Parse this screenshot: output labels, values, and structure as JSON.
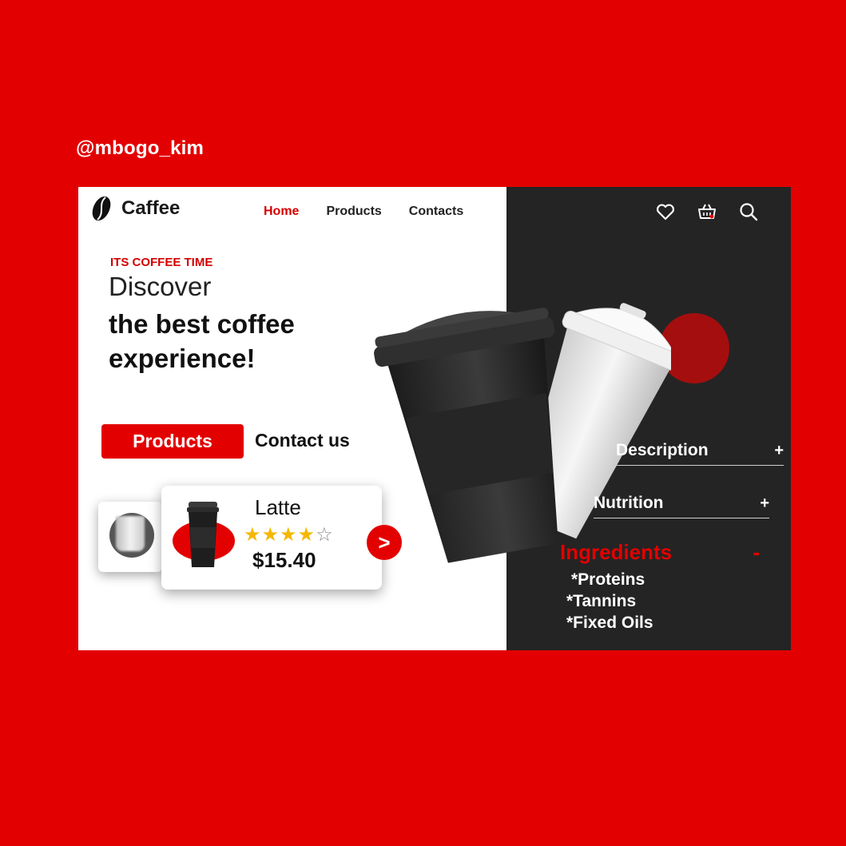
{
  "handle": "@mbogo_kim",
  "brand": {
    "name": "Caffee",
    "icon": "coffee-bean-icon"
  },
  "nav": {
    "items": [
      "Home",
      "Products",
      "Contacts"
    ],
    "active": "Home"
  },
  "top_icons": [
    "heart-icon",
    "basket-icon",
    "search-icon"
  ],
  "hero": {
    "eyebrow": "ITS COFFEE TIME",
    "line1": "Discover",
    "line2": "the best coffee experience!"
  },
  "buttons": {
    "primary": "Products",
    "secondary": "Contact us"
  },
  "product_card": {
    "name": "Latte",
    "rating": 4,
    "rating_max": 5,
    "price": "$15.40",
    "next_label": ">"
  },
  "accordion": {
    "description": {
      "label": "Description",
      "sign": "+"
    },
    "nutrition": {
      "label": "Nutrition",
      "sign": "+"
    },
    "ingredients": {
      "label": "Ingredients",
      "sign": "-",
      "items": [
        "*Proteins",
        "*Tannins",
        "*Fixed Oils"
      ]
    }
  },
  "colors": {
    "accent": "#e30000",
    "dark_panel": "#242424",
    "ball": "#a50e0e",
    "star": "#f5b800"
  }
}
